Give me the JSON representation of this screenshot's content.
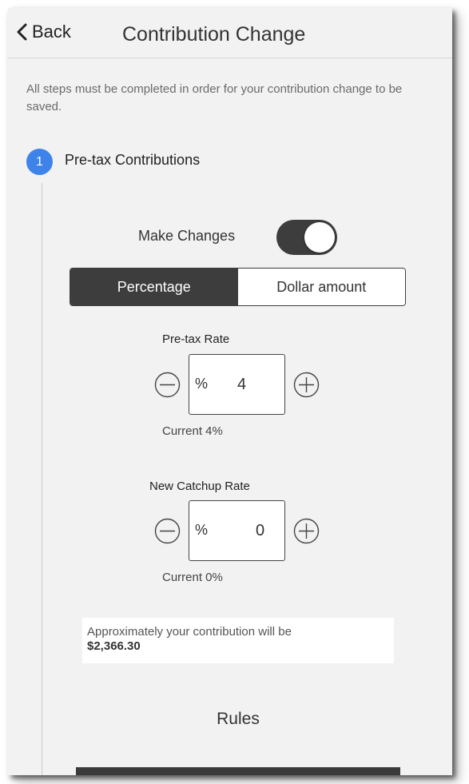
{
  "header": {
    "back_label": "Back",
    "title": "Contribution Change"
  },
  "intro_text": "All steps must be completed in order for your contribution change to be saved.",
  "step": {
    "number": "1",
    "title": "Pre-tax Contributions"
  },
  "make_changes": {
    "label": "Make Changes",
    "on": true
  },
  "mode_toggle": {
    "options": [
      "Percentage",
      "Dollar amount"
    ],
    "selected": "Percentage"
  },
  "pretax_rate": {
    "label": "Pre-tax Rate",
    "unit": "%",
    "value": "4",
    "current": "Current 4%"
  },
  "catchup_rate": {
    "label": "New Catchup Rate",
    "unit": "%",
    "value": "0",
    "current": "Current 0%"
  },
  "approximate": {
    "text": "Approximately your contribution will be",
    "amount": "$2,366.30"
  },
  "rules_label": "Rules",
  "colors": {
    "accent": "#3d83ea",
    "dark": "#3d3d3d",
    "background": "#f2f2f2"
  }
}
